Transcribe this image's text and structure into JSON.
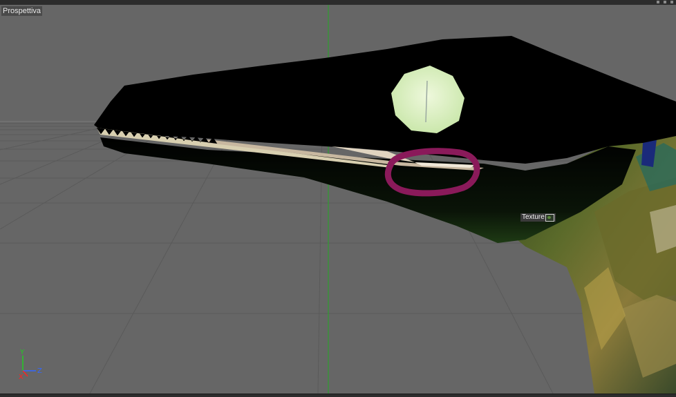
{
  "viewport": {
    "label": "Prospettiva",
    "background_color": "#666666",
    "axis_y_color": "#22aa22"
  },
  "tag": {
    "label": "Texture",
    "icon": "texture-tag-icon"
  },
  "axes": {
    "y": "Y",
    "z": "Z",
    "x": "X",
    "y_color": "#22cc22",
    "z_color": "#3366ff",
    "x_color": "#ff2222"
  },
  "annotation": {
    "color": "#8a1a5a"
  }
}
